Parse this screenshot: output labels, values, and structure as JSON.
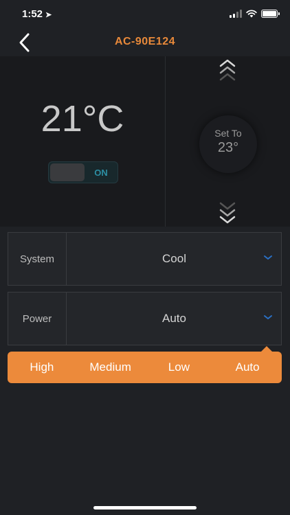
{
  "status_bar": {
    "time": "1:52",
    "location_glyph": "➤"
  },
  "nav": {
    "title": "AC-90E124",
    "back_icon": "chevron-left-icon"
  },
  "thermostat": {
    "current_temp": "21°C",
    "power_toggle_label": "ON",
    "set_to_label": "Set To",
    "set_to_value": "23°"
  },
  "settings": {
    "system": {
      "label": "System",
      "value": "Cool"
    },
    "power": {
      "label": "Power",
      "value": "Auto"
    }
  },
  "power_options": [
    "High",
    "Medium",
    "Low",
    "Auto"
  ],
  "colors": {
    "accent": "#ec8a3b",
    "title": "#e8893a",
    "chevron_blue": "#2a6fc4",
    "toggle_on": "#2c8ea3"
  }
}
